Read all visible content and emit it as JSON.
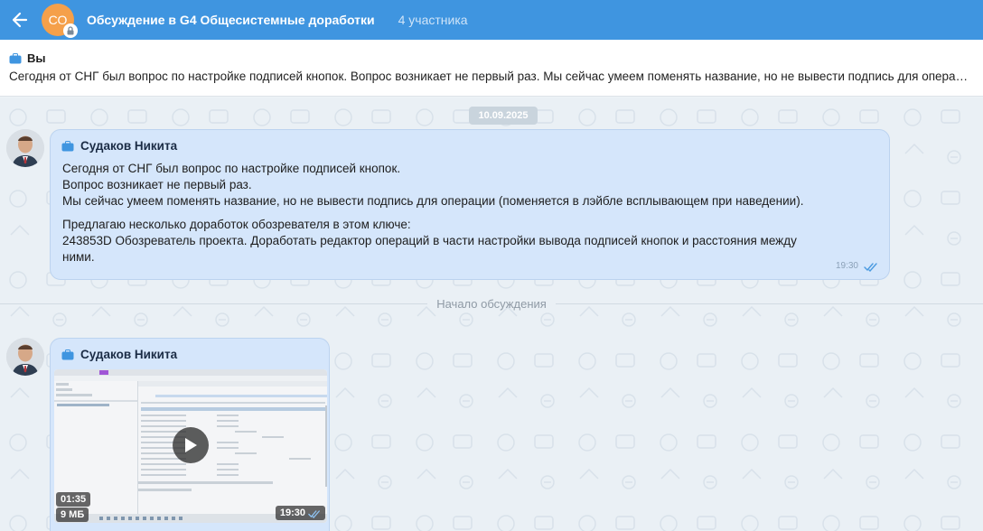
{
  "header": {
    "avatar_initials": "СО",
    "title": "Обсуждение в G4 Общесистемные доработки",
    "participants": "4 участника"
  },
  "pinned": {
    "author": "Вы",
    "text": "Сегодня от СНГ был вопрос по настройке подписей кнопок. Вопрос возникает не первый раз. Мы сейчас умеем поменять название, но не вывести подпись для операции (поменяется в лэйбле всплывающем при наведении)."
  },
  "chat": {
    "date": "10.09.2025",
    "divider": "Начало обсуждения",
    "messages": [
      {
        "author": "Судаков Никита",
        "lines": [
          "Сегодня от СНГ был вопрос по настройке подписей кнопок.",
          "Вопрос возникает не первый раз.",
          "Мы сейчас умеем поменять название, но не вывести подпись для операции (поменяется в лэйбле всплывающем при наведении)."
        ],
        "lines2": [
          "Предлагаю несколько доработок обозревателя в этом ключе:",
          "243853D Обозреватель проекта. Доработать редактор операций в части настройки вывода подписей кнопок и расстояния между",
          "ними."
        ],
        "time": "19:30"
      },
      {
        "author": "Судаков Никита",
        "video": {
          "duration": "01:35",
          "size": "9 МБ"
        },
        "time": "19:30"
      }
    ]
  },
  "colors": {
    "header_bg": "#3f95e0",
    "bubble_bg": "#d5e6fb",
    "avatar_bg": "#f5a04a"
  }
}
